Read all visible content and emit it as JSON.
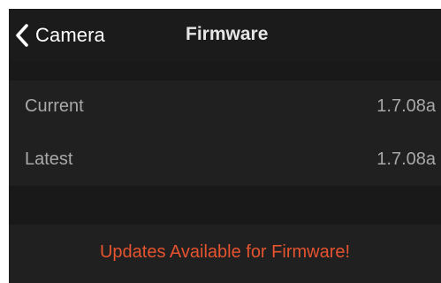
{
  "navbar": {
    "back_label": "Camera",
    "title": "Firmware"
  },
  "firmware": {
    "rows": [
      {
        "label": "Current",
        "value": "1.7.08a"
      },
      {
        "label": "Latest",
        "value": "1.7.08a"
      }
    ]
  },
  "update": {
    "label": "Updates Available for Firmware!"
  },
  "icons": {
    "back": "chevron-left-icon"
  },
  "colors": {
    "background": "#191919",
    "row_background": "#202020",
    "text_primary": "#ffffff",
    "text_secondary": "#a8a8a8",
    "accent": "#e5532f"
  }
}
